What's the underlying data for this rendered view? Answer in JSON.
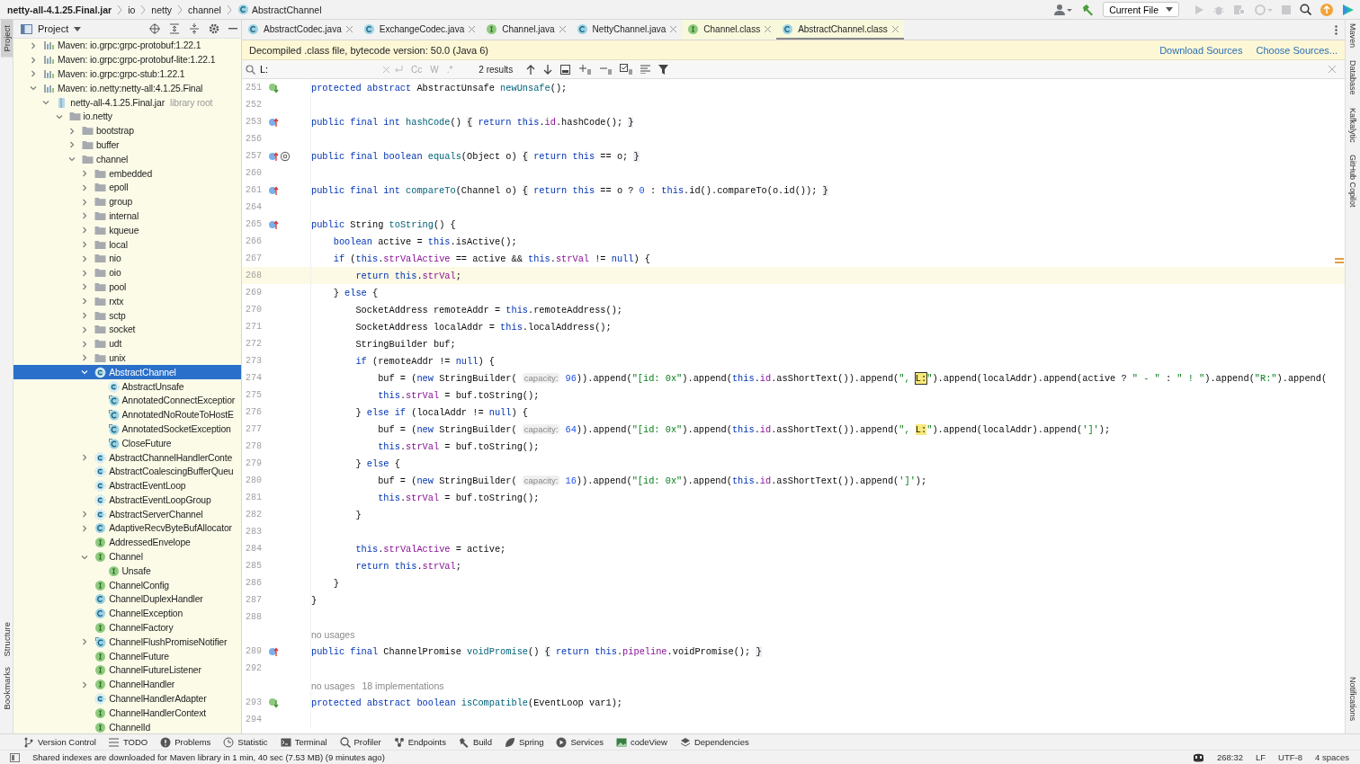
{
  "breadcrumbs": [
    {
      "label": "netty-all-4.1.25.Final.jar",
      "kind": "jar"
    },
    {
      "label": "io",
      "kind": "package"
    },
    {
      "label": "netty",
      "kind": "package"
    },
    {
      "label": "channel",
      "kind": "package"
    },
    {
      "label": "AbstractChannel",
      "kind": "class"
    }
  ],
  "run_config": "Current File",
  "left_strip": [
    {
      "label": "Project",
      "selected": true
    },
    {
      "label": "Structure",
      "selected": false
    },
    {
      "label": "Bookmarks",
      "selected": false
    }
  ],
  "right_strip": [
    "Maven",
    "Database",
    "Kafkalytic",
    "GitHub Copilot",
    "Notifications"
  ],
  "project": {
    "title": "Project",
    "tree": [
      {
        "label": "Maven: io.grpc:grpc-protobuf:1.22.1",
        "kind": "maven",
        "expanded": false,
        "selected": false
      },
      {
        "label": "Maven: io.grpc:grpc-protobuf-lite:1.22.1",
        "kind": "maven",
        "expanded": false,
        "selected": false
      },
      {
        "label": "Maven: io.grpc:grpc-stub:1.22.1",
        "kind": "maven",
        "expanded": false,
        "selected": false
      },
      {
        "label": "Maven: io.netty:netty-all:4.1.25.Final",
        "kind": "maven",
        "expanded": true,
        "selected": false,
        "children": [
          {
            "label": "netty-all-4.1.25.Final.jar",
            "note": "library root",
            "kind": "jar",
            "expanded": true,
            "selected": false,
            "children": [
              {
                "label": "io.netty",
                "kind": "folder",
                "expanded": true,
                "selected": false,
                "children": [
                  {
                    "label": "bootstrap",
                    "kind": "folder",
                    "expanded": false,
                    "selected": false
                  },
                  {
                    "label": "buffer",
                    "kind": "folder",
                    "expanded": false,
                    "selected": false
                  },
                  {
                    "label": "channel",
                    "kind": "folder",
                    "expanded": true,
                    "selected": false,
                    "children": [
                      {
                        "label": "embedded",
                        "kind": "folder",
                        "expanded": false,
                        "selected": false
                      },
                      {
                        "label": "epoll",
                        "kind": "folder",
                        "expanded": false,
                        "selected": false
                      },
                      {
                        "label": "group",
                        "kind": "folder",
                        "expanded": false,
                        "selected": false
                      },
                      {
                        "label": "internal",
                        "kind": "folder",
                        "expanded": false,
                        "selected": false
                      },
                      {
                        "label": "kqueue",
                        "kind": "folder",
                        "expanded": false,
                        "selected": false
                      },
                      {
                        "label": "local",
                        "kind": "folder",
                        "expanded": false,
                        "selected": false
                      },
                      {
                        "label": "nio",
                        "kind": "folder",
                        "expanded": false,
                        "selected": false
                      },
                      {
                        "label": "oio",
                        "kind": "folder",
                        "expanded": false,
                        "selected": false
                      },
                      {
                        "label": "pool",
                        "kind": "folder",
                        "expanded": false,
                        "selected": false
                      },
                      {
                        "label": "rxtx",
                        "kind": "folder",
                        "expanded": false,
                        "selected": false
                      },
                      {
                        "label": "sctp",
                        "kind": "folder",
                        "expanded": false,
                        "selected": false
                      },
                      {
                        "label": "socket",
                        "kind": "folder",
                        "expanded": false,
                        "selected": false
                      },
                      {
                        "label": "udt",
                        "kind": "folder",
                        "expanded": false,
                        "selected": false
                      },
                      {
                        "label": "unix",
                        "kind": "folder",
                        "expanded": false,
                        "selected": false
                      },
                      {
                        "label": "AbstractChannel",
                        "kind": "abstract-class",
                        "expanded": true,
                        "selected": true,
                        "children": [
                          {
                            "label": "AbstractUnsafe",
                            "kind": "abstract-class",
                            "selected": false
                          },
                          {
                            "label": "AnnotatedConnectExceptior",
                            "kind": "static-class",
                            "selected": false
                          },
                          {
                            "label": "AnnotatedNoRouteToHostE",
                            "kind": "static-class",
                            "selected": false
                          },
                          {
                            "label": "AnnotatedSocketException",
                            "kind": "static-class",
                            "selected": false
                          },
                          {
                            "label": "CloseFuture",
                            "kind": "static-class",
                            "selected": false
                          }
                        ]
                      },
                      {
                        "label": "AbstractChannelHandlerConte",
                        "kind": "abstract-class",
                        "expanded": false,
                        "selected": false
                      },
                      {
                        "label": "AbstractCoalescingBufferQueu",
                        "kind": "abstract-class",
                        "selected": false
                      },
                      {
                        "label": "AbstractEventLoop",
                        "kind": "abstract-class",
                        "selected": false
                      },
                      {
                        "label": "AbstractEventLoopGroup",
                        "kind": "abstract-class",
                        "selected": false
                      },
                      {
                        "label": "AbstractServerChannel",
                        "kind": "abstract-class",
                        "expanded": false,
                        "selected": false
                      },
                      {
                        "label": "AdaptiveRecvByteBufAllocator",
                        "kind": "class",
                        "expanded": false,
                        "selected": false
                      },
                      {
                        "label": "AddressedEnvelope",
                        "kind": "interface",
                        "selected": false
                      },
                      {
                        "label": "Channel",
                        "kind": "interface",
                        "expanded": true,
                        "selected": false,
                        "children": [
                          {
                            "label": "Unsafe",
                            "kind": "interface",
                            "selected": false
                          }
                        ]
                      },
                      {
                        "label": "ChannelConfig",
                        "kind": "interface",
                        "selected": false
                      },
                      {
                        "label": "ChannelDuplexHandler",
                        "kind": "class",
                        "selected": false
                      },
                      {
                        "label": "ChannelException",
                        "kind": "class",
                        "selected": false
                      },
                      {
                        "label": "ChannelFactory",
                        "kind": "interface",
                        "selected": false
                      },
                      {
                        "label": "ChannelFlushPromiseNotifier",
                        "kind": "static-class",
                        "expanded": false,
                        "selected": false
                      },
                      {
                        "label": "ChannelFuture",
                        "kind": "interface",
                        "selected": false
                      },
                      {
                        "label": "ChannelFutureListener",
                        "kind": "interface",
                        "selected": false
                      },
                      {
                        "label": "ChannelHandler",
                        "kind": "interface",
                        "expanded": false,
                        "selected": false
                      },
                      {
                        "label": "ChannelHandlerAdapter",
                        "kind": "abstract-class",
                        "selected": false
                      },
                      {
                        "label": "ChannelHandlerContext",
                        "kind": "interface",
                        "selected": false
                      },
                      {
                        "label": "ChannelId",
                        "kind": "interface",
                        "selected": false
                      }
                    ]
                  }
                ]
              }
            ]
          }
        ]
      }
    ]
  },
  "tabs": [
    {
      "label": "AbstractCodec.java",
      "kind": "class",
      "library": false,
      "selected": false
    },
    {
      "label": "ExchangeCodec.java",
      "kind": "class",
      "library": false,
      "selected": false
    },
    {
      "label": "Channel.java",
      "kind": "interface",
      "library": false,
      "selected": false
    },
    {
      "label": "NettyChannel.java",
      "kind": "class",
      "library": false,
      "selected": false
    },
    {
      "label": "Channel.class",
      "kind": "interface",
      "library": true,
      "selected": false
    },
    {
      "label": "AbstractChannel.class",
      "kind": "class",
      "library": true,
      "selected": true
    }
  ],
  "banner": {
    "message": "Decompiled .class file, bytecode version: 50.0 (Java 6)",
    "links": [
      "Download Sources",
      "Choose Sources..."
    ]
  },
  "find": {
    "value": "L:",
    "options": [
      "Cc",
      "W",
      ".*"
    ],
    "results": "2 results"
  },
  "code": [
    {
      "number": "251",
      "gutter": [
        {
          "kind": "implemented"
        }
      ],
      "tokens": [
        {
          "kind": "kw",
          "text": "protected abstract "
        },
        {
          "kind": "plain",
          "text": "AbstractUnsafe "
        },
        {
          "kind": "method",
          "text": "newUnsafe"
        },
        {
          "kind": "plain",
          "text": "();"
        }
      ]
    },
    {
      "number": "252"
    },
    {
      "number": "253",
      "gutter": [
        {
          "kind": "overrides"
        }
      ],
      "tokens": [
        {
          "kind": "kw",
          "text": "public final int "
        },
        {
          "kind": "method",
          "text": "hashCode"
        },
        {
          "kind": "plain",
          "text": "() "
        },
        {
          "kind": "fold",
          "text": "{"
        },
        {
          "kind": "kw",
          "text": " return this"
        },
        {
          "kind": "plain",
          "text": "."
        },
        {
          "kind": "field",
          "text": "id"
        },
        {
          "kind": "plain",
          "text": ".hashCode(); "
        },
        {
          "kind": "fold",
          "text": "}"
        }
      ]
    },
    {
      "number": "256"
    },
    {
      "number": "257",
      "gutter": [
        {
          "kind": "overrides"
        },
        {
          "kind": "annotated"
        }
      ],
      "tokens": [
        {
          "kind": "kw",
          "text": "public final boolean "
        },
        {
          "kind": "method",
          "text": "equals"
        },
        {
          "kind": "plain",
          "text": "(Object o) "
        },
        {
          "kind": "fold",
          "text": "{"
        },
        {
          "kind": "kw",
          "text": " return this"
        },
        {
          "kind": "plain",
          "text": " == o; "
        },
        {
          "kind": "fold",
          "text": "}"
        }
      ]
    },
    {
      "number": "260"
    },
    {
      "number": "261",
      "gutter": [
        {
          "kind": "overrides"
        }
      ],
      "tokens": [
        {
          "kind": "kw",
          "text": "public final int "
        },
        {
          "kind": "method",
          "text": "compareTo"
        },
        {
          "kind": "plain",
          "text": "(Channel o) "
        },
        {
          "kind": "fold",
          "text": "{"
        },
        {
          "kind": "kw",
          "text": " return this"
        },
        {
          "kind": "plain",
          "text": " == o ? "
        },
        {
          "kind": "num",
          "text": "0"
        },
        {
          "kind": "plain",
          "text": " : "
        },
        {
          "kind": "kw",
          "text": "this"
        },
        {
          "kind": "plain",
          "text": ".id().compareTo(o.id()); "
        },
        {
          "kind": "fold",
          "text": "}"
        }
      ]
    },
    {
      "number": "264"
    },
    {
      "number": "265",
      "gutter": [
        {
          "kind": "overrides"
        }
      ],
      "tokens": [
        {
          "kind": "kw",
          "text": "public "
        },
        {
          "kind": "plain",
          "text": "String "
        },
        {
          "kind": "method",
          "text": "toString"
        },
        {
          "kind": "plain",
          "text": "() {"
        }
      ]
    },
    {
      "number": "266",
      "tokens": [
        {
          "kind": "kw",
          "text": "    boolean "
        },
        {
          "kind": "plain",
          "text": "active = "
        },
        {
          "kind": "kw",
          "text": "this"
        },
        {
          "kind": "plain",
          "text": ".isActive();"
        }
      ]
    },
    {
      "number": "267",
      "tokens": [
        {
          "kind": "kw",
          "text": "    if "
        },
        {
          "kind": "plain",
          "text": "("
        },
        {
          "kind": "kw",
          "text": "this"
        },
        {
          "kind": "plain",
          "text": "."
        },
        {
          "kind": "field",
          "text": "strValActive"
        },
        {
          "kind": "plain",
          "text": " == active && "
        },
        {
          "kind": "kw",
          "text": "this"
        },
        {
          "kind": "plain",
          "text": "."
        },
        {
          "kind": "field",
          "text": "strVal"
        },
        {
          "kind": "plain",
          "text": " != "
        },
        {
          "kind": "kw",
          "text": "null"
        },
        {
          "kind": "plain",
          "text": ") {"
        }
      ]
    },
    {
      "number": "268",
      "current": true,
      "tokens": [
        {
          "kind": "kw",
          "text": "        return this"
        },
        {
          "kind": "plain",
          "text": "."
        },
        {
          "kind": "field",
          "text": "strVal"
        },
        {
          "kind": "plain",
          "text": ";"
        }
      ]
    },
    {
      "number": "269",
      "tokens": [
        {
          "kind": "plain",
          "text": "    } "
        },
        {
          "kind": "kw",
          "text": "else"
        },
        {
          "kind": "plain",
          "text": " {"
        }
      ]
    },
    {
      "number": "270",
      "tokens": [
        {
          "kind": "plain",
          "text": "        SocketAddress remoteAddr = "
        },
        {
          "kind": "kw",
          "text": "this"
        },
        {
          "kind": "plain",
          "text": ".remoteAddress();"
        }
      ]
    },
    {
      "number": "271",
      "tokens": [
        {
          "kind": "plain",
          "text": "        SocketAddress localAddr = "
        },
        {
          "kind": "kw",
          "text": "this"
        },
        {
          "kind": "plain",
          "text": ".localAddress();"
        }
      ]
    },
    {
      "number": "272",
      "tokens": [
        {
          "kind": "plain",
          "text": "        StringBuilder buf;"
        }
      ]
    },
    {
      "number": "273",
      "tokens": [
        {
          "kind": "kw",
          "text": "        if "
        },
        {
          "kind": "plain",
          "text": "(remoteAddr != "
        },
        {
          "kind": "kw",
          "text": "null"
        },
        {
          "kind": "plain",
          "text": ") {"
        }
      ]
    },
    {
      "number": "274",
      "tokens": [
        {
          "kind": "plain",
          "text": "            buf = ("
        },
        {
          "kind": "kw",
          "text": "new "
        },
        {
          "kind": "plain",
          "text": "StringBuilder( "
        },
        {
          "kind": "hint",
          "text": "capacity:"
        },
        {
          "kind": "num",
          "text": " 96"
        },
        {
          "kind": "plain",
          "text": ")).append("
        },
        {
          "kind": "str",
          "text": "\"[id: 0x\""
        },
        {
          "kind": "plain",
          "text": ").append("
        },
        {
          "kind": "kw",
          "text": "this"
        },
        {
          "kind": "plain",
          "text": "."
        },
        {
          "kind": "field",
          "text": "id"
        },
        {
          "kind": "plain",
          "text": ".asShortText()).append("
        },
        {
          "kind": "str",
          "text": "\", "
        },
        {
          "kind": "current-match",
          "text": "L:"
        },
        {
          "kind": "str",
          "text": "\""
        },
        {
          "kind": "plain",
          "text": ").append(localAddr).append(active ? "
        },
        {
          "kind": "str",
          "text": "\" - \""
        },
        {
          "kind": "plain",
          "text": " : "
        },
        {
          "kind": "str",
          "text": "\" ! \""
        },
        {
          "kind": "plain",
          "text": ").append("
        },
        {
          "kind": "str",
          "text": "\"R:\""
        },
        {
          "kind": "plain",
          "text": ").append("
        }
      ]
    },
    {
      "number": "275",
      "tokens": [
        {
          "kind": "kw",
          "text": "            this"
        },
        {
          "kind": "plain",
          "text": "."
        },
        {
          "kind": "field",
          "text": "strVal"
        },
        {
          "kind": "plain",
          "text": " = buf.toString();"
        }
      ]
    },
    {
      "number": "276",
      "tokens": [
        {
          "kind": "plain",
          "text": "        } "
        },
        {
          "kind": "kw",
          "text": "else if "
        },
        {
          "kind": "plain",
          "text": "(localAddr != "
        },
        {
          "kind": "kw",
          "text": "null"
        },
        {
          "kind": "plain",
          "text": ") {"
        }
      ]
    },
    {
      "number": "277",
      "tokens": [
        {
          "kind": "plain",
          "text": "            buf = ("
        },
        {
          "kind": "kw",
          "text": "new "
        },
        {
          "kind": "plain",
          "text": "StringBuilder( "
        },
        {
          "kind": "hint",
          "text": "capacity:"
        },
        {
          "kind": "num",
          "text": " 64"
        },
        {
          "kind": "plain",
          "text": ")).append("
        },
        {
          "kind": "str",
          "text": "\"[id: 0x\""
        },
        {
          "kind": "plain",
          "text": ").append("
        },
        {
          "kind": "kw",
          "text": "this"
        },
        {
          "kind": "plain",
          "text": "."
        },
        {
          "kind": "field",
          "text": "id"
        },
        {
          "kind": "plain",
          "text": ".asShortText()).append("
        },
        {
          "kind": "str",
          "text": "\", "
        },
        {
          "kind": "match",
          "text": "L:"
        },
        {
          "kind": "str",
          "text": "\""
        },
        {
          "kind": "plain",
          "text": ").append(localAddr).append("
        },
        {
          "kind": "str",
          "text": "']'"
        },
        {
          "kind": "plain",
          "text": ");"
        }
      ]
    },
    {
      "number": "278",
      "tokens": [
        {
          "kind": "kw",
          "text": "            this"
        },
        {
          "kind": "plain",
          "text": "."
        },
        {
          "kind": "field",
          "text": "strVal"
        },
        {
          "kind": "plain",
          "text": " = buf.toString();"
        }
      ]
    },
    {
      "number": "279",
      "tokens": [
        {
          "kind": "plain",
          "text": "        } "
        },
        {
          "kind": "kw",
          "text": "else"
        },
        {
          "kind": "plain",
          "text": " {"
        }
      ]
    },
    {
      "number": "280",
      "tokens": [
        {
          "kind": "plain",
          "text": "            buf = ("
        },
        {
          "kind": "kw",
          "text": "new "
        },
        {
          "kind": "plain",
          "text": "StringBuilder( "
        },
        {
          "kind": "hint",
          "text": "capacity:"
        },
        {
          "kind": "num",
          "text": " 16"
        },
        {
          "kind": "plain",
          "text": ")).append("
        },
        {
          "kind": "str",
          "text": "\"[id: 0x\""
        },
        {
          "kind": "plain",
          "text": ").append("
        },
        {
          "kind": "kw",
          "text": "this"
        },
        {
          "kind": "plain",
          "text": "."
        },
        {
          "kind": "field",
          "text": "id"
        },
        {
          "kind": "plain",
          "text": ".asShortText()).append("
        },
        {
          "kind": "str",
          "text": "']'"
        },
        {
          "kind": "plain",
          "text": ");"
        }
      ]
    },
    {
      "number": "281",
      "tokens": [
        {
          "kind": "kw",
          "text": "            this"
        },
        {
          "kind": "plain",
          "text": "."
        },
        {
          "kind": "field",
          "text": "strVal"
        },
        {
          "kind": "plain",
          "text": " = buf.toString();"
        }
      ]
    },
    {
      "number": "282",
      "tokens": [
        {
          "kind": "plain",
          "text": "        }"
        }
      ]
    },
    {
      "number": "283"
    },
    {
      "number": "284",
      "tokens": [
        {
          "kind": "kw",
          "text": "        this"
        },
        {
          "kind": "plain",
          "text": "."
        },
        {
          "kind": "field",
          "text": "strValActive"
        },
        {
          "kind": "plain",
          "text": " = active;"
        }
      ]
    },
    {
      "number": "285",
      "tokens": [
        {
          "kind": "kw",
          "text": "        return this"
        },
        {
          "kind": "plain",
          "text": "."
        },
        {
          "kind": "field",
          "text": "strVal"
        },
        {
          "kind": "plain",
          "text": ";"
        }
      ]
    },
    {
      "number": "286",
      "tokens": [
        {
          "kind": "plain",
          "text": "    }"
        }
      ]
    },
    {
      "number": "287",
      "tokens": [
        {
          "kind": "plain",
          "text": "}"
        }
      ]
    },
    {
      "number": "288"
    },
    {
      "kind": "usages",
      "texts": [
        "no usages"
      ]
    },
    {
      "number": "289",
      "gutter": [
        {
          "kind": "overrides"
        }
      ],
      "tokens": [
        {
          "kind": "kw",
          "text": "public final "
        },
        {
          "kind": "plain",
          "text": "ChannelPromise "
        },
        {
          "kind": "method",
          "text": "voidPromise"
        },
        {
          "kind": "plain",
          "text": "() "
        },
        {
          "kind": "fold",
          "text": "{"
        },
        {
          "kind": "kw",
          "text": " return this"
        },
        {
          "kind": "plain",
          "text": "."
        },
        {
          "kind": "field",
          "text": "pipeline"
        },
        {
          "kind": "plain",
          "text": ".voidPromise(); "
        },
        {
          "kind": "fold",
          "text": "}"
        }
      ]
    },
    {
      "number": "292"
    },
    {
      "kind": "usages",
      "texts": [
        "no usages",
        "18 implementations"
      ]
    },
    {
      "number": "293",
      "gutter": [
        {
          "kind": "implemented"
        }
      ],
      "tokens": [
        {
          "kind": "kw",
          "text": "protected abstract boolean "
        },
        {
          "kind": "method",
          "text": "isCompatible"
        },
        {
          "kind": "plain",
          "text": "(EventLoop var1);"
        }
      ]
    },
    {
      "number": "294"
    }
  ],
  "tool_windows": [
    {
      "label": "Version Control",
      "kind": "vcs"
    },
    {
      "label": "TODO",
      "kind": "list"
    },
    {
      "label": "Problems",
      "kind": "problems"
    },
    {
      "label": "Statistic",
      "kind": "clock"
    },
    {
      "label": "Terminal",
      "kind": "terminal"
    },
    {
      "label": "Profiler",
      "kind": "profiler"
    },
    {
      "label": "Endpoints",
      "kind": "endpoints"
    },
    {
      "label": "Build",
      "kind": "hammer"
    },
    {
      "label": "Spring",
      "kind": "leaf"
    },
    {
      "label": "Services",
      "kind": "play"
    },
    {
      "label": "codeView",
      "kind": "image"
    },
    {
      "label": "Dependencies",
      "kind": "layers"
    }
  ],
  "status_bar": {
    "message": "Shared indexes are downloaded for Maven library in 1 min, 40 sec (7.53 MB) (9 minutes ago)",
    "items": [
      "268:32",
      "LF",
      "UTF-8",
      "4 spaces"
    ]
  }
}
